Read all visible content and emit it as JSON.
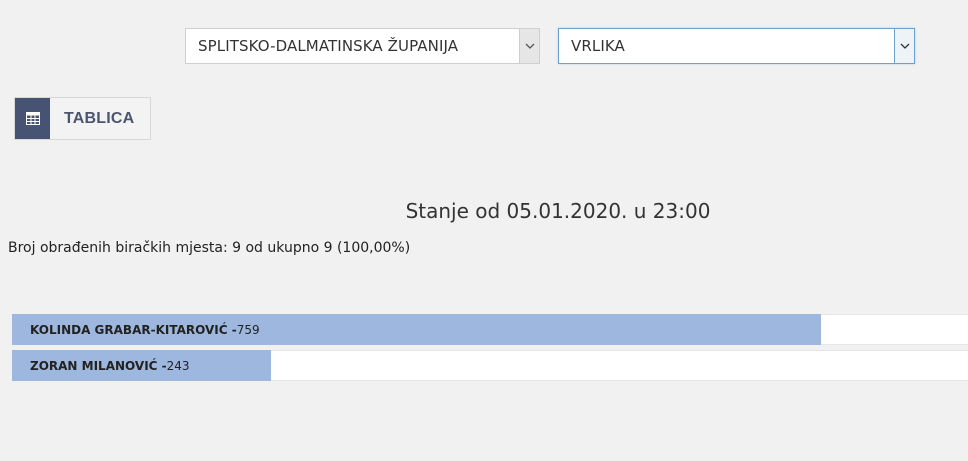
{
  "filters": {
    "county": "SPLITSKO-DALMATINSKA ŽUPANIJA",
    "town": "VRLIKA"
  },
  "view_button": {
    "label": "TABLICA",
    "icon": "table-icon"
  },
  "status_text": "Stanje od 05.01.2020. u 23:00",
  "processed_text": "Broj obrađenih biračkih mjesta: 9 od ukupno 9 (100,00%)",
  "colors": {
    "bar_fill": "#9db7de",
    "button_icon_bg": "#475373"
  },
  "results": [
    {
      "name": "KOLINDA GRABAR-KITAROVIĆ",
      "separator": " - ",
      "votes": "759",
      "share": 0.846
    },
    {
      "name": "ZORAN MILANOVIĆ",
      "separator": " - ",
      "votes": "243",
      "share": 0.271
    }
  ]
}
